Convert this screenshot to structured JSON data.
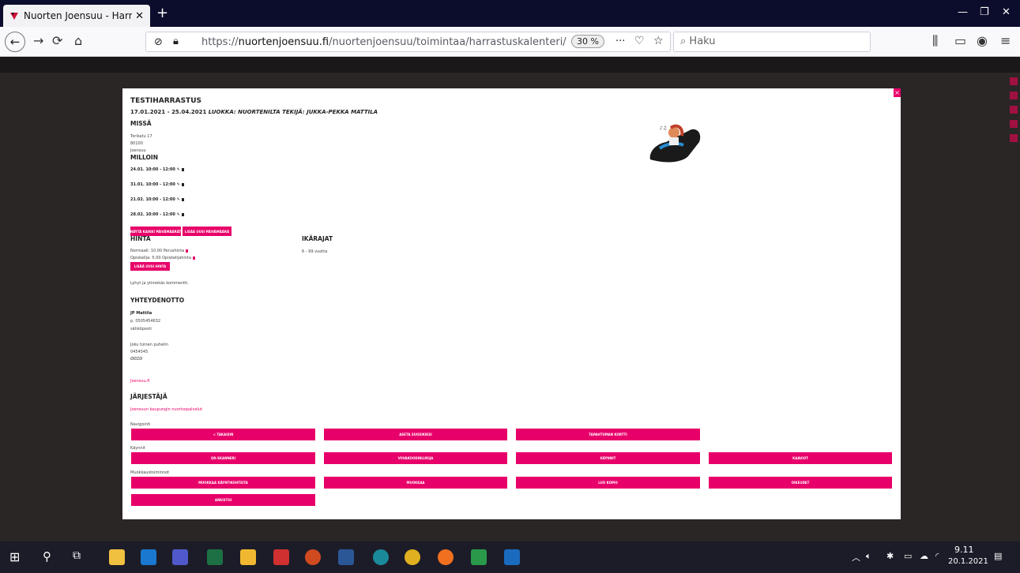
{
  "browser": {
    "tab_title": "Nuorten Joensuu - Harrastuskal",
    "tab_close": "✕",
    "new_tab": "+",
    "url_prefix": "https://",
    "url_domain": "nuortenjoensuu.fi",
    "url_path": "/nuortenjoensuu/toimintaa/harrastuskalenteri/",
    "zoom": "30 %",
    "search_placeholder": "Haku",
    "more": "···"
  },
  "modal": {
    "close": "×",
    "title": "TESTIHARRASTUS",
    "dates_line": "17.01.2021 - 25.04.2021",
    "class_label": "LUOKKA: NUORTENILTA TEKIJÄ: JUKKA-PEKKA MATTILA",
    "where_heading": "MISSÄ",
    "address": [
      "Torikatu 17",
      "80100",
      "Joensuu"
    ],
    "when_heading": "MILLOIN",
    "times": [
      "24.01. 10:00 - 12:00",
      "31.01. 10:00 - 12:00",
      "21.02. 10:00 - 12:00",
      "28.02. 10:00 - 12:00"
    ],
    "show_dates_btn": "NÄYTÄ KAIKKI PÄIVÄMÄÄRÄT",
    "add_date_btn": "LISÄÄ UUSI PÄIVÄMÄÄRÄ",
    "price_heading": "HINTA",
    "prices": [
      "Normaali: 10.00 Perushinta",
      "Opiskelija: 5.00 Opiskelijahinta"
    ],
    "add_price_btn": "LISÄÄ UUSI HINTA",
    "age_heading": "IKÄRAJAT",
    "age_value": "6 - 99 vuotta",
    "comment": "Lyhyt ja ytimekäs kommentti.",
    "contact_heading": "YHTEYDENOTTO",
    "contact": {
      "name": "JP Mattila",
      "phone": "p. 0505454632",
      "email": "sähköposti",
      "extra": [
        "Joku toinen puhelin",
        "0454545",
        "ØØZØ"
      ],
      "link": "Joensuu.fi"
    },
    "organizer_heading": "JÄRJESTÄJÄ",
    "organizer_link": "Joensuun kaupungin nuorisopalvelut",
    "nav_label": "Navigointi",
    "nav_buttons": [
      "< TAKAISIN",
      "ASETA SUOSIKIKSI",
      "TAPAHTUMAN KORTTI"
    ],
    "visits_label": "Käynnit",
    "visits_buttons": [
      "QR-SKANNERI",
      "VIIVAKOODINLUKIJA",
      "KÄYNNIT",
      "KAAVIOT"
    ],
    "edit_label": "Muokkaustoiminnot",
    "edit_buttons": [
      "MUOKKAA KÄYNTIKOHTEITA",
      "MUOKKAA",
      "LUO KOPIO",
      "OIKEUDET"
    ],
    "archive_btn": "ARKISTOI"
  },
  "taskbar": {
    "time": "9.11",
    "date": "20.1.2021"
  }
}
